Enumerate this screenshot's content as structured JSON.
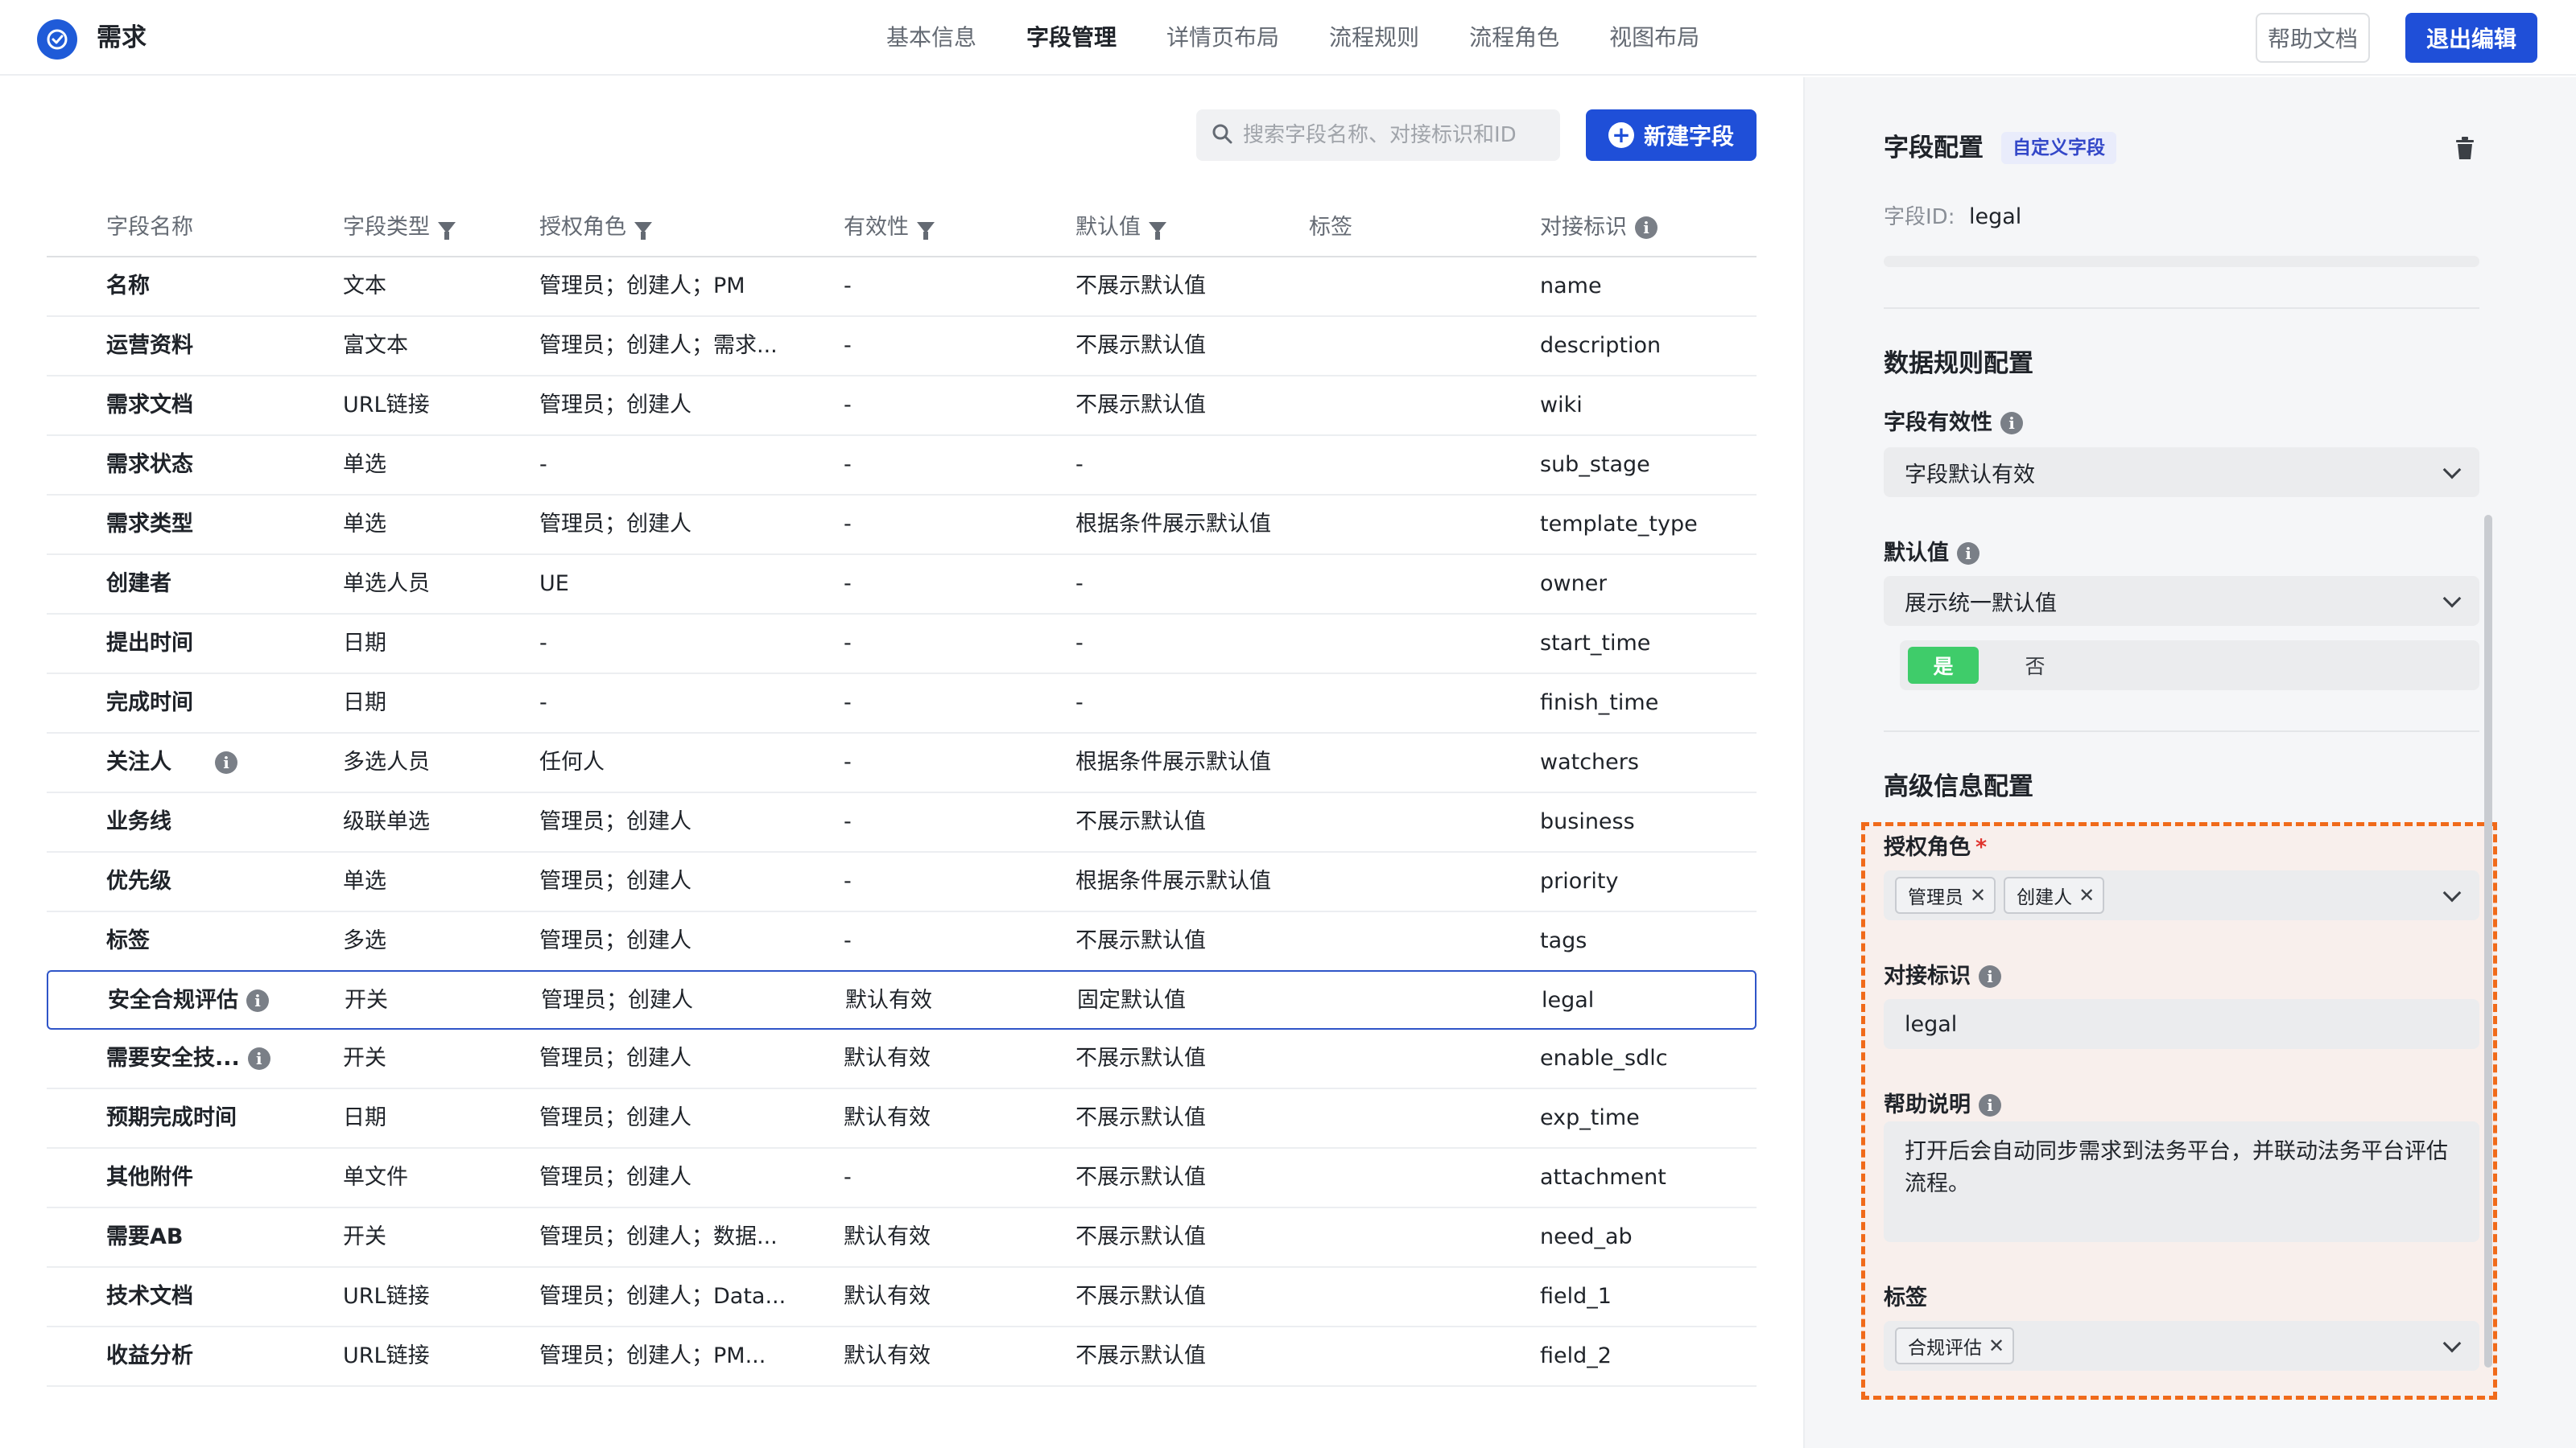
{
  "app": {
    "title": "需求"
  },
  "nav": {
    "tabs": [
      "基本信息",
      "字段管理",
      "详情页布局",
      "流程规则",
      "流程角色",
      "视图布局"
    ],
    "active_index": 1
  },
  "header_actions": {
    "help": "帮助文档",
    "exit": "退出编辑"
  },
  "toolbar": {
    "search_placeholder": "搜索字段名称、对接标识和ID",
    "new_field": "新建字段"
  },
  "table": {
    "columns": [
      "字段名称",
      "字段类型",
      "授权角色",
      "有效性",
      "默认值",
      "标签",
      "对接标识"
    ],
    "rows": [
      {
        "name": "名称",
        "type": "文本",
        "roles": "管理员；创建人；PM",
        "validity": "-",
        "default": "不展示默认值",
        "tags": "",
        "key": "name",
        "info": false
      },
      {
        "name": "运营资料",
        "type": "富文本",
        "roles": "管理员；创建人；需求...",
        "validity": "-",
        "default": "不展示默认值",
        "tags": "",
        "key": "description",
        "info": false
      },
      {
        "name": "需求文档",
        "type": "URL链接",
        "roles": "管理员；创建人",
        "validity": "-",
        "default": "不展示默认值",
        "tags": "",
        "key": "wiki",
        "info": false
      },
      {
        "name": "需求状态",
        "type": "单选",
        "roles": "-",
        "validity": "-",
        "default": "-",
        "tags": "",
        "key": "sub_stage",
        "info": false
      },
      {
        "name": "需求类型",
        "type": "单选",
        "roles": "管理员；创建人",
        "validity": "-",
        "default": "根据条件展示默认值",
        "tags": "",
        "key": "template_type",
        "info": false
      },
      {
        "name": "创建者",
        "type": "单选人员",
        "roles": "UE",
        "validity": "-",
        "default": "-",
        "tags": "",
        "key": "owner",
        "info": false
      },
      {
        "name": "提出时间",
        "type": "日期",
        "roles": "-",
        "validity": "-",
        "default": "-",
        "tags": "",
        "key": "start_time",
        "info": false
      },
      {
        "name": "完成时间",
        "type": "日期",
        "roles": "-",
        "validity": "-",
        "default": "-",
        "tags": "",
        "key": "finish_time",
        "info": false
      },
      {
        "name": "关注人",
        "type": "多选人员",
        "roles": "任何人",
        "validity": "-",
        "default": "根据条件展示默认值",
        "tags": "",
        "key": "watchers",
        "info": true
      },
      {
        "name": "业务线",
        "type": "级联单选",
        "roles": "管理员；创建人",
        "validity": "-",
        "default": "不展示默认值",
        "tags": "",
        "key": "business",
        "info": false
      },
      {
        "name": "优先级",
        "type": "单选",
        "roles": "管理员；创建人",
        "validity": "-",
        "default": "根据条件展示默认值",
        "tags": "",
        "key": "priority",
        "info": false
      },
      {
        "name": "标签",
        "type": "多选",
        "roles": "管理员；创建人",
        "validity": "-",
        "default": "不展示默认值",
        "tags": "",
        "key": "tags",
        "info": false
      },
      {
        "name": "安全合规评估",
        "type": "开关",
        "roles": "管理员；创建人",
        "validity": "默认有效",
        "default": "固定默认值",
        "tags": "",
        "key": "legal",
        "info": true,
        "selected": true
      },
      {
        "name": "需要安全技...",
        "type": "开关",
        "roles": "管理员；创建人",
        "validity": "默认有效",
        "default": "不展示默认值",
        "tags": "",
        "key": "enable_sdlc",
        "info": true
      },
      {
        "name": "预期完成时间",
        "type": "日期",
        "roles": "管理员；创建人",
        "validity": "默认有效",
        "default": "不展示默认值",
        "tags": "",
        "key": "exp_time",
        "info": false
      },
      {
        "name": "其他附件",
        "type": "单文件",
        "roles": "管理员；创建人",
        "validity": "-",
        "default": "不展示默认值",
        "tags": "",
        "key": "attachment",
        "info": false
      },
      {
        "name": "需要AB",
        "type": "开关",
        "roles": "管理员；创建人；数据...",
        "validity": "默认有效",
        "default": "不展示默认值",
        "tags": "",
        "key": "need_ab",
        "info": false
      },
      {
        "name": "技术文档",
        "type": "URL链接",
        "roles": "管理员；创建人；Data...",
        "validity": "默认有效",
        "default": "不展示默认值",
        "tags": "",
        "key": "field_1",
        "info": false
      },
      {
        "name": "收益分析",
        "type": "URL链接",
        "roles": "管理员；创建人；PM...",
        "validity": "默认有效",
        "default": "不展示默认值",
        "tags": "",
        "key": "field_2",
        "info": false
      }
    ]
  },
  "panel": {
    "title": "字段配置",
    "badge": "自定义字段",
    "field_id_label": "字段ID:",
    "field_id_value": "legal",
    "data_rules_title": "数据规则配置",
    "validity_label": "字段有效性",
    "validity_value": "字段默认有效",
    "default_label": "默认值",
    "default_value": "展示统一默认值",
    "toggle_yes": "是",
    "toggle_no": "否",
    "advanced_title": "高级信息配置",
    "roles_label": "授权角色",
    "roles_required": "*",
    "roles_tags": [
      "管理员",
      "创建人"
    ],
    "key_label": "对接标识",
    "key_value": "legal",
    "help_label": "帮助说明",
    "help_text": "打开后会自动同步需求到法务平台，并联动法务平台评估流程。",
    "tags_label": "标签",
    "tags": [
      "合规评估"
    ]
  },
  "colors": {
    "primary": "#1f4fd8",
    "highlight_border": "#f06a1a",
    "toggle_on": "#3fcc6a"
  }
}
